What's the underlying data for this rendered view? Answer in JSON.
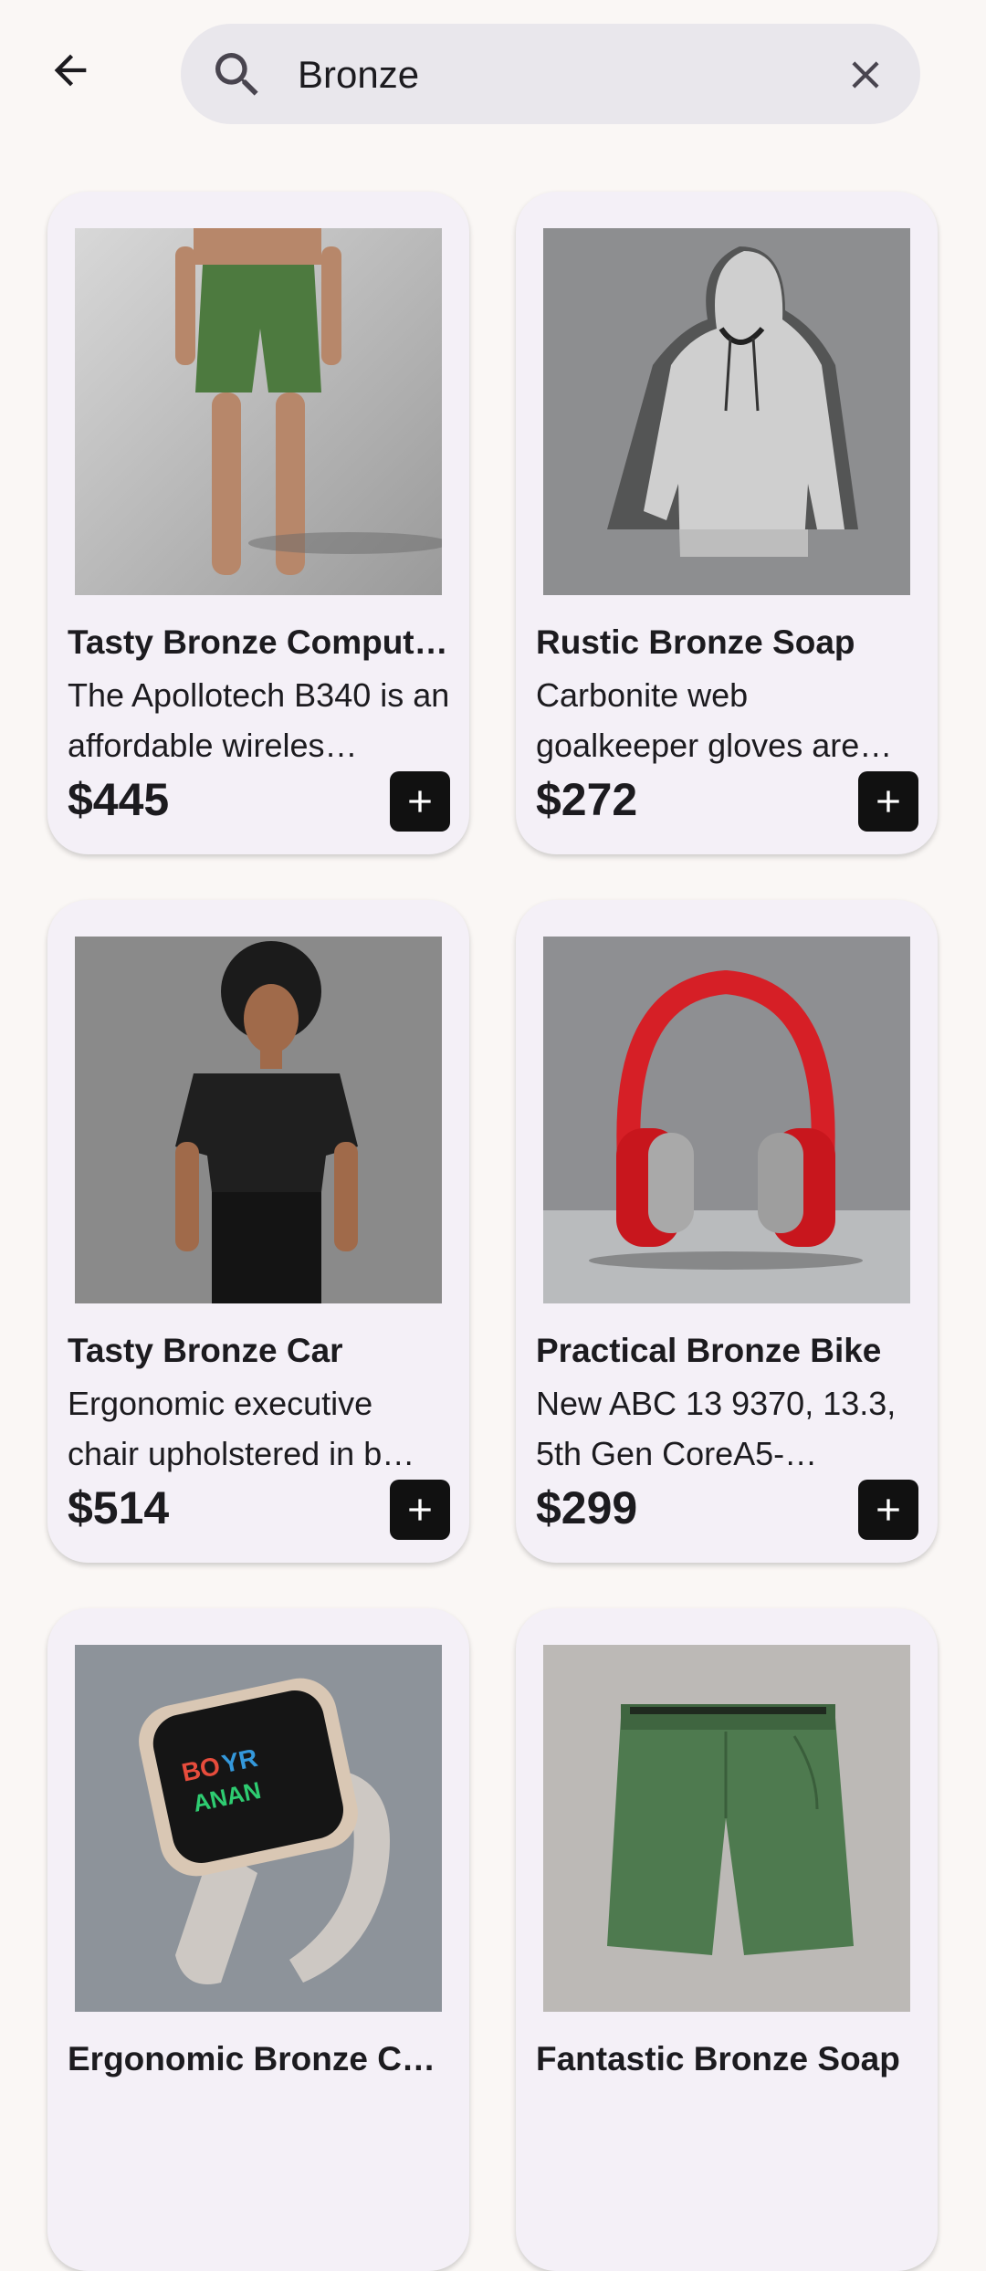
{
  "search": {
    "query": "Bronze",
    "placeholder": ""
  },
  "icons": {
    "back": "arrow-left-icon",
    "search": "search-icon",
    "clear": "close-icon",
    "add": "plus-icon"
  },
  "colors": {
    "background": "#faf7f5",
    "card": "#f4f0f7",
    "search_bg": "#e9e7ec",
    "add_button": "#111111"
  },
  "products": [
    {
      "title": "Tasty Bronze Comput…",
      "desc": "The Apollotech B340 is an affordable wireles…",
      "price": "$445",
      "image": "green shorts on model"
    },
    {
      "title": "Rustic Bronze Soap",
      "desc": "Carbonite web goalkeeper gloves are…",
      "price": "$272",
      "image": "grey hoodie"
    },
    {
      "title": "Tasty Bronze Car",
      "desc": "Ergonomic executive chair upholstered in b…",
      "price": "$514",
      "image": "black t-shirt on model"
    },
    {
      "title": "Practical Bronze Bike",
      "desc": "New ABC 13 9370, 13.3, 5th Gen CoreA5-…",
      "price": "$299",
      "image": "red headphones"
    },
    {
      "title": "Ergonomic Bronze Ch…",
      "desc": "",
      "price": "",
      "image": "smartwatch"
    },
    {
      "title": "Fantastic Bronze Soap",
      "desc": "",
      "price": "",
      "image": "green shorts"
    }
  ]
}
